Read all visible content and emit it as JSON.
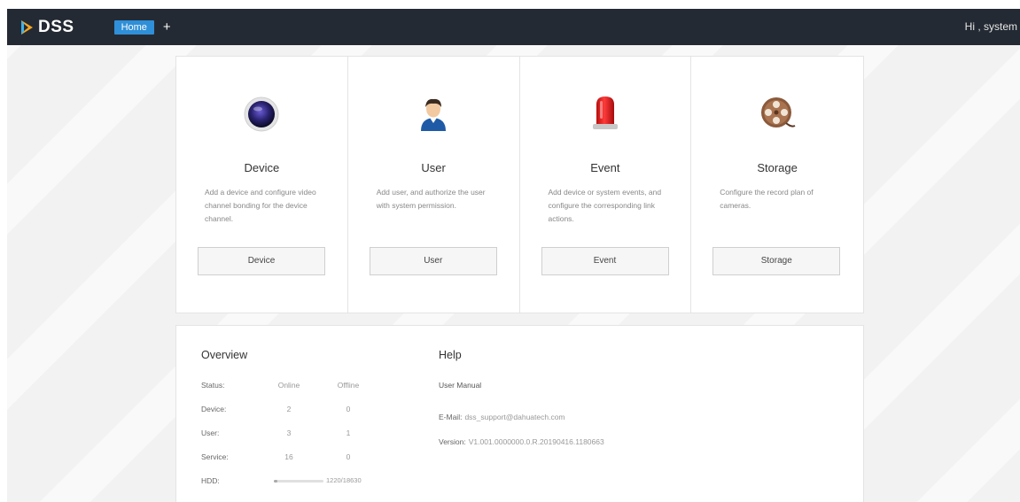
{
  "app": {
    "logo_text": "DSS",
    "greeting": "Hi , system"
  },
  "tabs": {
    "home": "Home",
    "add": "+"
  },
  "cards": [
    {
      "title": "Device",
      "desc": "Add a device and configure video channel bonding for the device channel.",
      "button": "Device",
      "icon": "camera-lens-icon"
    },
    {
      "title": "User",
      "desc": "Add user, and authorize the user with system permission.",
      "button": "User",
      "icon": "user-avatar-icon"
    },
    {
      "title": "Event",
      "desc": "Add device or system events, and configure the corresponding link actions.",
      "button": "Event",
      "icon": "alarm-siren-icon"
    },
    {
      "title": "Storage",
      "desc": "Configure the record plan of cameras.",
      "button": "Storage",
      "icon": "film-reel-icon"
    }
  ],
  "overview": {
    "title": "Overview",
    "headers": {
      "status": "Status:",
      "online": "Online",
      "offline": "Offline"
    },
    "rows": [
      {
        "label": "Device:",
        "online": "2",
        "offline": "0"
      },
      {
        "label": "User:",
        "online": "3",
        "offline": "1"
      },
      {
        "label": "Service:",
        "online": "16",
        "offline": "0"
      }
    ],
    "hdd": {
      "label": "HDD:",
      "text": "1220/18630",
      "fraction": 0.065
    }
  },
  "help": {
    "title": "Help",
    "manual": "User Manual",
    "email_label": "E-Mail:",
    "email": "dss_support@dahuatech.com",
    "version_label": "Version:",
    "version": "V1.001.0000000.0.R.20190416.1180663"
  },
  "colors": {
    "topbar": "#242a33",
    "accent": "#2f8fd8",
    "siren": "#e01f1f"
  }
}
